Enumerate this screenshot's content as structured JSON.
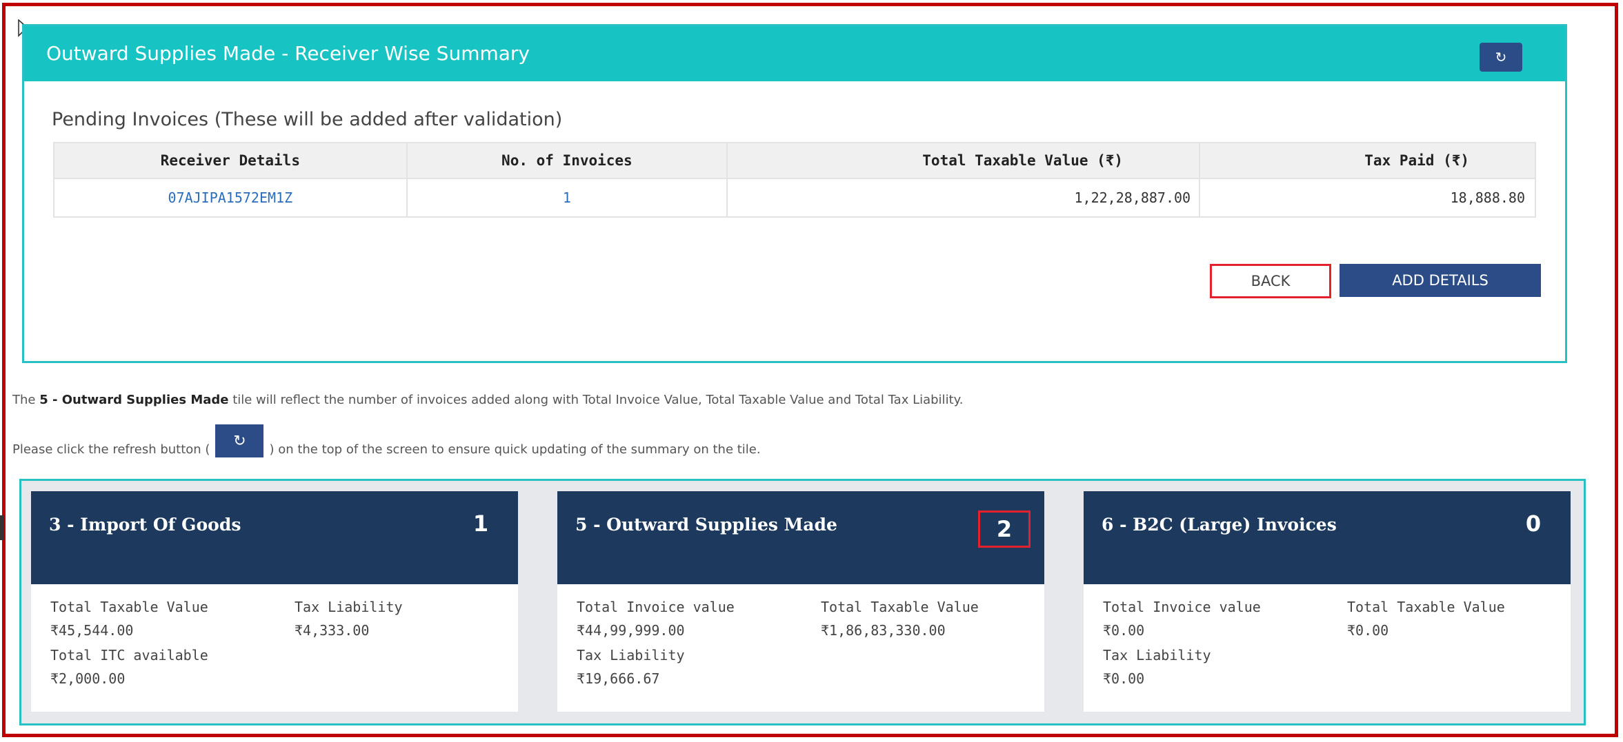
{
  "panel": {
    "title": "Outward Supplies Made - Receiver Wise Summary",
    "refresh_icon": "↻",
    "pending_title": "Pending Invoices (These will be added after validation)",
    "table": {
      "headers": [
        "Receiver Details",
        "No. of Invoices",
        "Total Taxable Value (₹)",
        "Tax Paid (₹)"
      ],
      "rows": [
        {
          "receiver": "07AJIPA1572EM1Z",
          "invoices": "1",
          "taxable": "1,22,28,887.00",
          "tax": "18,888.80"
        }
      ]
    },
    "back_label": "BACK",
    "add_label": "ADD DETAILS"
  },
  "info": {
    "line1_prefix": "The ",
    "line1_bold": "5 - Outward Supplies Made",
    "line1_suffix": " tile will reflect the number of invoices added along with Total Invoice Value, Total Taxable Value and Total Tax Liability.",
    "line2_prefix": "Please click the refresh button (",
    "line2_suffix": ") on the top of the screen to ensure quick updating of the summary on the tile."
  },
  "tiles": [
    {
      "title": "3 - Import Of Goods",
      "count": "1",
      "stats": [
        {
          "label": "Total Taxable Value",
          "value": "₹45,544.00"
        },
        {
          "label": "Tax Liability",
          "value": "₹4,333.00"
        },
        {
          "label": "Total ITC available",
          "value": "₹2,000.00"
        }
      ]
    },
    {
      "title": "5 - Outward Supplies Made",
      "count": "2",
      "stats": [
        {
          "label": "Total Invoice value",
          "value": "₹44,99,999.00"
        },
        {
          "label": "Total Taxable Value",
          "value": "₹1,86,83,330.00"
        },
        {
          "label": "Tax Liability",
          "value": "₹19,666.67"
        }
      ]
    },
    {
      "title": "6 - B2C (Large) Invoices",
      "count": "0",
      "stats": [
        {
          "label": "Total Invoice value",
          "value": "₹0.00"
        },
        {
          "label": "Total Taxable Value",
          "value": "₹0.00"
        },
        {
          "label": "Tax Liability",
          "value": "₹0.00"
        }
      ]
    }
  ],
  "colors": {
    "header_teal": "#17c4c3",
    "button_navy": "#2b4c86",
    "tile_navy": "#1d3a5e",
    "highlight_red": "#e3222b"
  }
}
